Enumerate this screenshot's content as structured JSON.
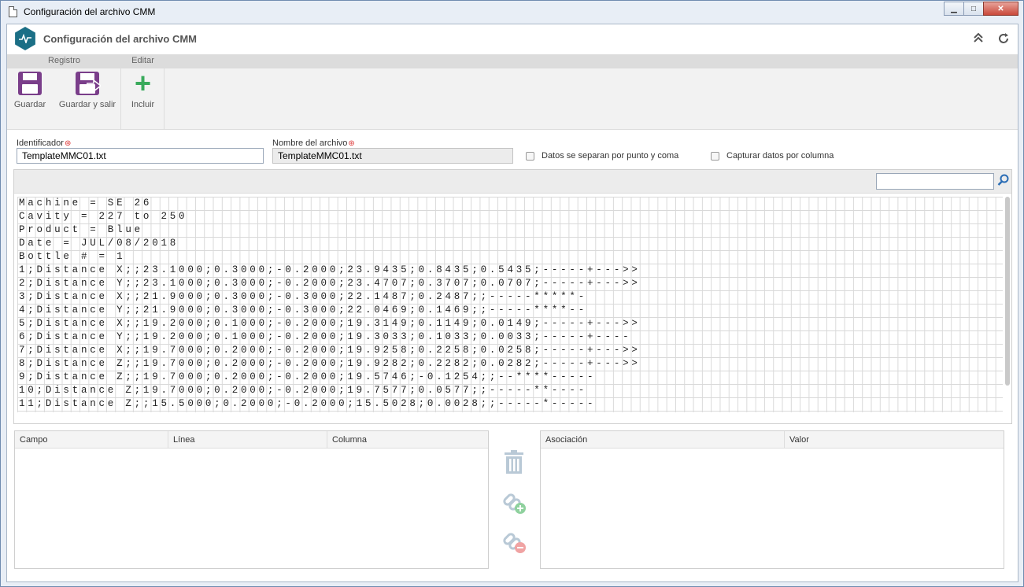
{
  "window": {
    "title": "Configuración del archivo CMM",
    "controls": {
      "minimize": "▁",
      "maximize": "□",
      "close": "✕"
    }
  },
  "app": {
    "title": "Configuración del archivo CMM",
    "icons": [
      "collapse-icon",
      "refresh-icon"
    ]
  },
  "ribbon": {
    "groups": [
      {
        "label": "Registro",
        "buttons": [
          {
            "label": "Guardar",
            "icon": "floppy-disk-icon"
          },
          {
            "label": "Guardar y salir",
            "icon": "save-exit-icon"
          }
        ]
      },
      {
        "label": "Editar",
        "buttons": [
          {
            "label": "Incluir",
            "icon": "plus-icon"
          }
        ]
      }
    ]
  },
  "form": {
    "identificador": {
      "label": "Identificador",
      "value": "TemplateMMC01.txt"
    },
    "nombre_archivo": {
      "label": "Nombre del archivo",
      "value": "TemplateMMC01.txt"
    },
    "chk_punto_coma": {
      "label": "Datos se separan por punto y coma",
      "checked": false
    },
    "chk_columna": {
      "label": "Capturar datos por columna",
      "checked": false
    }
  },
  "grid": {
    "search_value": "",
    "lines": [
      "Machine = SE 26",
      "Cavity = 227 to 250",
      "Product = Blue",
      "Date = JUL/08/2018",
      "Bottle # = 1",
      "1;Distance X;;23.1000;0.3000;-0.2000;23.9435;0.8435;0.5435;-----+--->>",
      "2;Distance Y;;23.1000;0.3000;-0.2000;23.4707;0.3707;0.0707;-----+--->>",
      "3;Distance X;;21.9000;0.3000;-0.3000;22.1487;0.2487;;-----*****-",
      "4;Distance Y;;21.9000;0.3000;-0.3000;22.0469;0.1469;;-----****--",
      "5;Distance X;;19.2000;0.1000;-0.2000;19.3149;0.1149;0.0149;-----+--->>",
      "6;Distance Y;;19.2000;0.1000;-0.2000;19.3033;0.1033;0.0033;-----+----",
      "7;Distance X;;19.7000;0.2000;-0.2000;19.9258;0.2258;0.0258;-----+--->>",
      "8;Distance Z;;19.7000;0.2000;-0.2000;19.9282;0.2282;0.0282;-----+--->>",
      "9;Distance Z;;19.7000;0.2000;-0.2000;19.5746;-0.1254;;--****-----",
      "10;Distance Z;19.7000;0.2000;-0.2000;19.7577;0.0577;;-----**----",
      "11;Distance Z;;15.5000;0.2000;-0.2000;15.5028;0.0028;;-----*-----"
    ]
  },
  "table_left": {
    "columns": [
      "Campo",
      "Línea",
      "Columna"
    ],
    "rows": []
  },
  "table_right": {
    "columns": [
      "Asociación",
      "Valor"
    ],
    "rows": []
  },
  "side_actions": [
    "trash-icon",
    "link-add-icon",
    "link-remove-icon"
  ]
}
